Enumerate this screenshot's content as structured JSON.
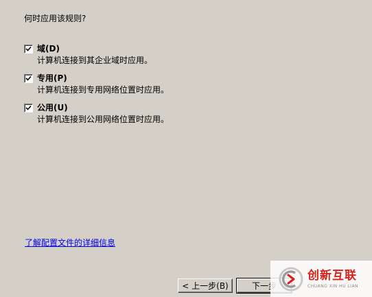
{
  "question": "何时应用该规则?",
  "options": [
    {
      "label": "域(D)",
      "description": "计算机连接到其企业域时应用。",
      "checked": true
    },
    {
      "label": "专用(P)",
      "description": "计算机连接到专用网络位置时应用。",
      "checked": true
    },
    {
      "label": "公用(U)",
      "description": "计算机连接到公用网络位置时应用。",
      "checked": true
    }
  ],
  "link": "了解配置文件的详细信息",
  "buttons": {
    "back": "< 上一步(B)",
    "next": "下一步"
  },
  "watermark": {
    "title": "创新互联",
    "subtitle": "CHUANG XIN HU LIAN",
    "icon": "chuangxin-logo-icon",
    "color": "#d8211b"
  }
}
